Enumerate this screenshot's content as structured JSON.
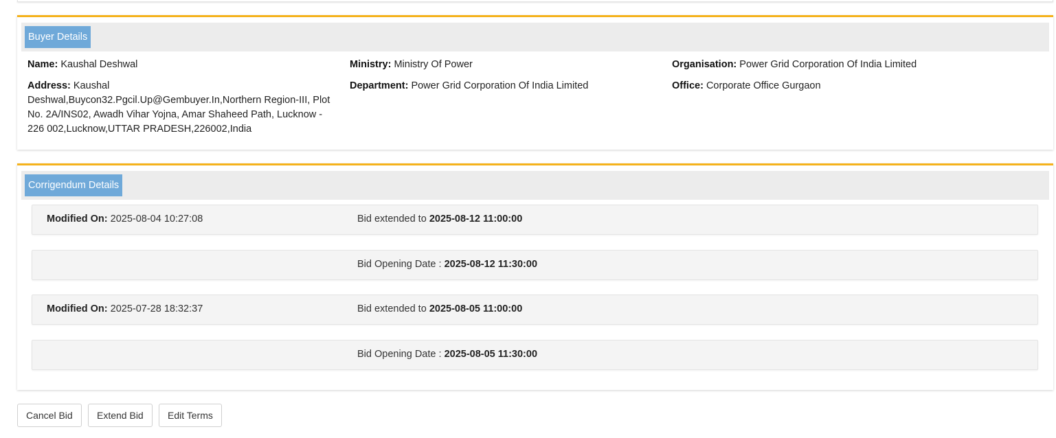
{
  "buyer": {
    "heading": "Buyer Details",
    "name_label": "Name:",
    "name": "Kaushal Deshwal",
    "ministry_label": "Ministry:",
    "ministry": "Ministry Of Power",
    "organisation_label": "Organisation:",
    "organisation": "Power Grid Corporation Of India Limited",
    "address_label": "Address:",
    "address": "Kaushal Deshwal,Buycon32.Pgcil.Up@Gembuyer.In,Northern Region-III, Plot No. 2A/INS02, Awadh Vihar Yojna, Amar Shaheed Path, Lucknow - 226 002,Lucknow,UTTAR PRADESH,226002,India",
    "department_label": "Department:",
    "department": "Power Grid Corporation Of India Limited",
    "office_label": "Office:",
    "office": "Corporate Office Gurgaon"
  },
  "corrigendum": {
    "heading": "Corrigendum Details",
    "rows": [
      {
        "modified_label": "Modified On:",
        "modified_on": "2025-08-04 10:27:08",
        "text": "Bid extended to ",
        "value": "2025-08-12 11:00:00"
      },
      {
        "modified_label": "",
        "modified_on": "",
        "text": "Bid Opening Date : ",
        "value": "2025-08-12 11:30:00"
      },
      {
        "modified_label": "Modified On:",
        "modified_on": "2025-07-28 18:32:37",
        "text": "Bid extended to ",
        "value": "2025-08-05 11:00:00"
      },
      {
        "modified_label": "",
        "modified_on": "",
        "text": "Bid Opening Date : ",
        "value": "2025-08-05 11:30:00"
      }
    ]
  },
  "actions": {
    "cancel_bid": "Cancel Bid",
    "extend_bid": "Extend Bid",
    "edit_terms": "Edit Terms"
  },
  "colors": {
    "accent_border": "#f5b21c",
    "heading_badge": "#6fa9d9",
    "heading_bg": "#ececec"
  }
}
